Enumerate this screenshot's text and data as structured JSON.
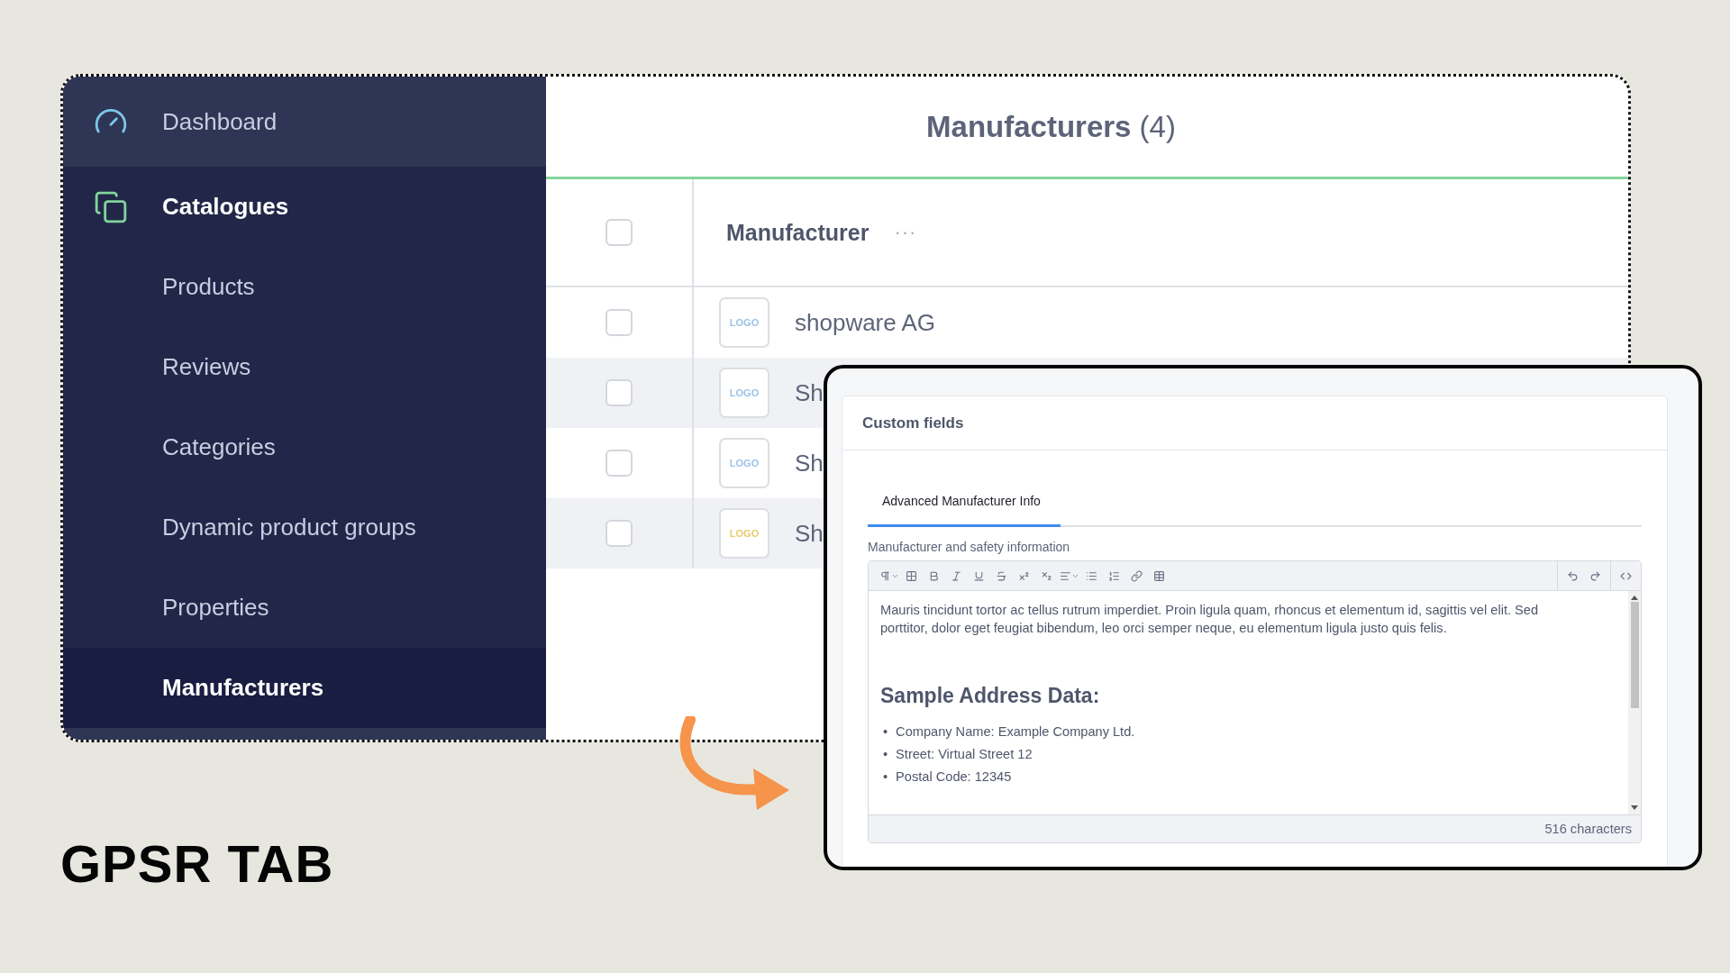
{
  "sidebar": {
    "items": [
      {
        "label": "Dashboard",
        "kind": "section",
        "expanded": false
      },
      {
        "label": "Catalogues",
        "kind": "section",
        "expanded": true,
        "children": [
          {
            "label": "Products",
            "selected": false
          },
          {
            "label": "Reviews",
            "selected": false
          },
          {
            "label": "Categories",
            "selected": false
          },
          {
            "label": "Dynamic product groups",
            "selected": false
          },
          {
            "label": "Properties",
            "selected": false
          },
          {
            "label": "Manufacturers",
            "selected": true
          }
        ]
      }
    ]
  },
  "page": {
    "title": "Manufacturers",
    "count": "(4)"
  },
  "table": {
    "header": {
      "checked": false,
      "label": "Manufacturer",
      "menu": "···"
    },
    "rows": [
      {
        "checked": false,
        "logo": "LOGO",
        "color": "#9cc3e8",
        "name": "shopware AG"
      },
      {
        "checked": false,
        "logo": "LOGO",
        "color": "#9cc3e8",
        "name": "Sh"
      },
      {
        "checked": false,
        "logo": "LOGO",
        "color": "#9cc3e8",
        "name": "Sh"
      },
      {
        "checked": false,
        "logo": "LOGO",
        "color": "#e6cc6c",
        "name": "Sh"
      }
    ]
  },
  "custom_fields": {
    "title": "Custom fields",
    "tabs": [
      {
        "label": "Advanced Manufacturer Info",
        "selected": true
      }
    ],
    "field_label": "Manufacturer and safety information",
    "editor": {
      "paragraph": "Mauris tincidunt tortor ac tellus rutrum imperdiet. Proin ligula quam, rhoncus et elementum id, sagittis vel elit. Sed porttitor, dolor eget feugiat bibendum, leo orci semper neque, eu elementum ligula justo quis felis.",
      "heading": "Sample Address Data:",
      "list": [
        {
          "marker": "•",
          "text": "Company Name: Example Company Ltd."
        },
        {
          "marker": "•",
          "text": "Street: Virtual Street 12"
        },
        {
          "marker": "•",
          "text": "Postal Code: 12345"
        }
      ],
      "char_count": "516 characters"
    }
  },
  "caption": "GPSR TAB"
}
